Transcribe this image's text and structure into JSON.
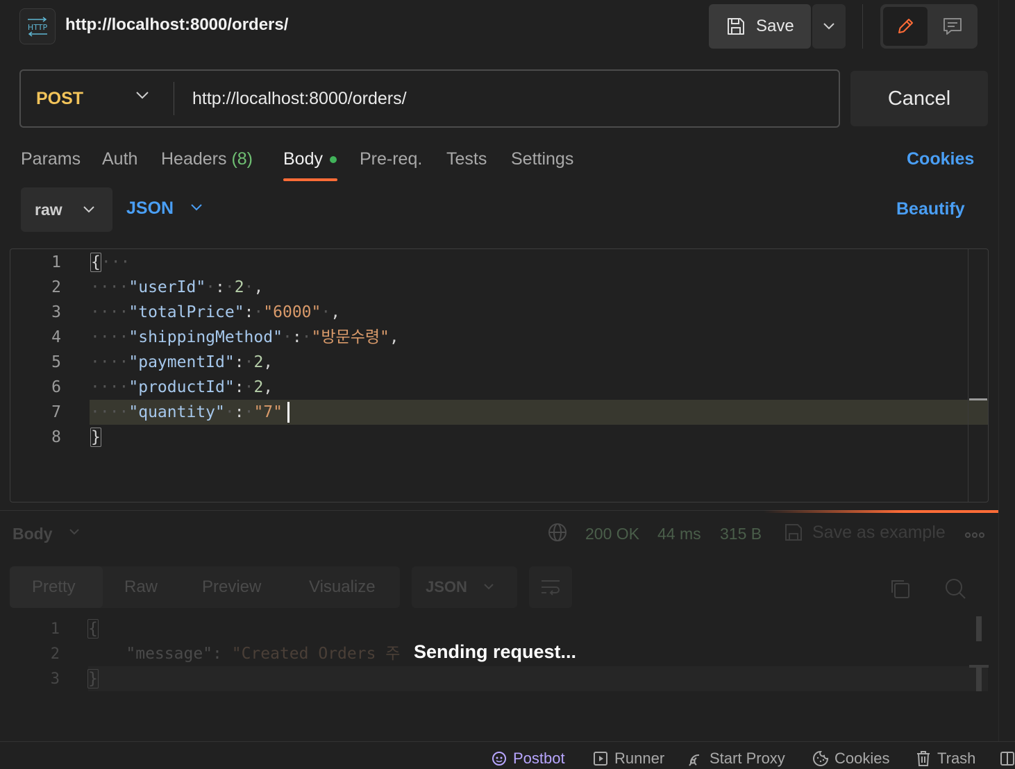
{
  "header": {
    "badge_label": "HTTP",
    "title": "http://localhost:8000/orders/",
    "save_label": "Save"
  },
  "request": {
    "method": "POST",
    "url": "http://localhost:8000/orders/",
    "cancel_label": "Cancel"
  },
  "tabs": {
    "params": "Params",
    "auth": "Auth",
    "headers": "Headers",
    "headers_count": "(8)",
    "body": "Body",
    "prereq": "Pre-req.",
    "tests": "Tests",
    "settings": "Settings",
    "cookies": "Cookies"
  },
  "body_mode": {
    "type": "raw",
    "format": "JSON",
    "beautify": "Beautify"
  },
  "editor": {
    "line_numbers": [
      "1",
      "2",
      "3",
      "4",
      "5",
      "6",
      "7",
      "8"
    ],
    "lines": {
      "l1": {
        "brace": "{"
      },
      "l2": {
        "key": "\"userId\"",
        "value": "2"
      },
      "l3": {
        "key": "\"totalPrice\"",
        "value": "\"6000\""
      },
      "l4": {
        "key": "\"shippingMethod\"",
        "value": "\"방문수령\""
      },
      "l5": {
        "key": "\"paymentId\"",
        "value": "2"
      },
      "l6": {
        "key": "\"productId\"",
        "value": "2"
      },
      "l7": {
        "key": "\"quantity\"",
        "value": "\"7\""
      },
      "l8": {
        "brace": "}"
      }
    }
  },
  "response": {
    "label": "Body",
    "status": "200 OK",
    "time": "44 ms",
    "size": "315 B",
    "save_example": "Save as example",
    "tabs": [
      "Pretty",
      "Raw",
      "Preview",
      "Visualize"
    ],
    "format": "JSON",
    "line_numbers": [
      "1",
      "2",
      "3"
    ],
    "line1": "{",
    "line2_key": "\"message\"",
    "line2_value": "\"Created Orders 주",
    "line3": "}",
    "overlay": "Sending request..."
  },
  "status_bar": {
    "postbot": "Postbot",
    "runner": "Runner",
    "start_proxy": "Start Proxy",
    "cookies": "Cookies",
    "trash": "Trash"
  },
  "colors": {
    "accent": "#ff6c37",
    "link": "#4a9ff5",
    "method": "#f3c45a",
    "success": "#41b35a"
  }
}
